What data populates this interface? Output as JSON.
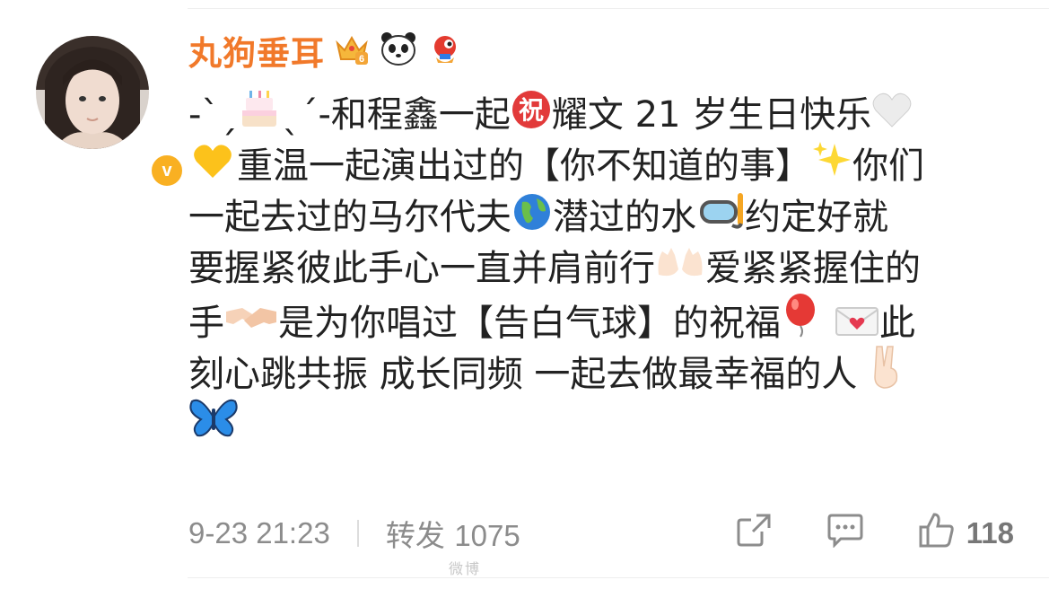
{
  "author": {
    "name": "丸狗垂耳",
    "verified_symbol": "v",
    "level_badge": "6",
    "name_color": "#f1792a"
  },
  "post": {
    "line1_a": "-ˋˏ",
    "line1_b": "ˎˊ-和程鑫一起",
    "line1_c": "耀文 21 岁生日快乐",
    "line2_a": "重温一起演出过的【你不知道的事】",
    "line2_b": "你们",
    "line3_a": "一起去过的马尔代夫",
    "line3_b": "潜过的水",
    "line3_c": "约定好就",
    "line4_a": "要握紧彼此手心一直并肩前行",
    "line4_b": "爱紧紧握住的",
    "line5_a": "手",
    "line5_b": "是为你唱过【告白气球】的祝福",
    "line5_c": "此",
    "line6_a": "刻心跳共振 成长同频 一起去做最幸福的人",
    "icons": [
      "cake-icon",
      "congrats-icon",
      "white-heart-icon",
      "yellow-heart-icon",
      "sparkles-icon",
      "globe-icon",
      "diving-mask-icon",
      "open-hands-icon",
      "handshake-icon",
      "balloon-icon",
      "love-letter-icon",
      "victory-hand-icon",
      "butterfly-icon"
    ]
  },
  "footer": {
    "time": "9-23 21:23",
    "repost_label": "转发",
    "repost_count": "1075",
    "like_count": "118"
  },
  "watermark": "微博"
}
